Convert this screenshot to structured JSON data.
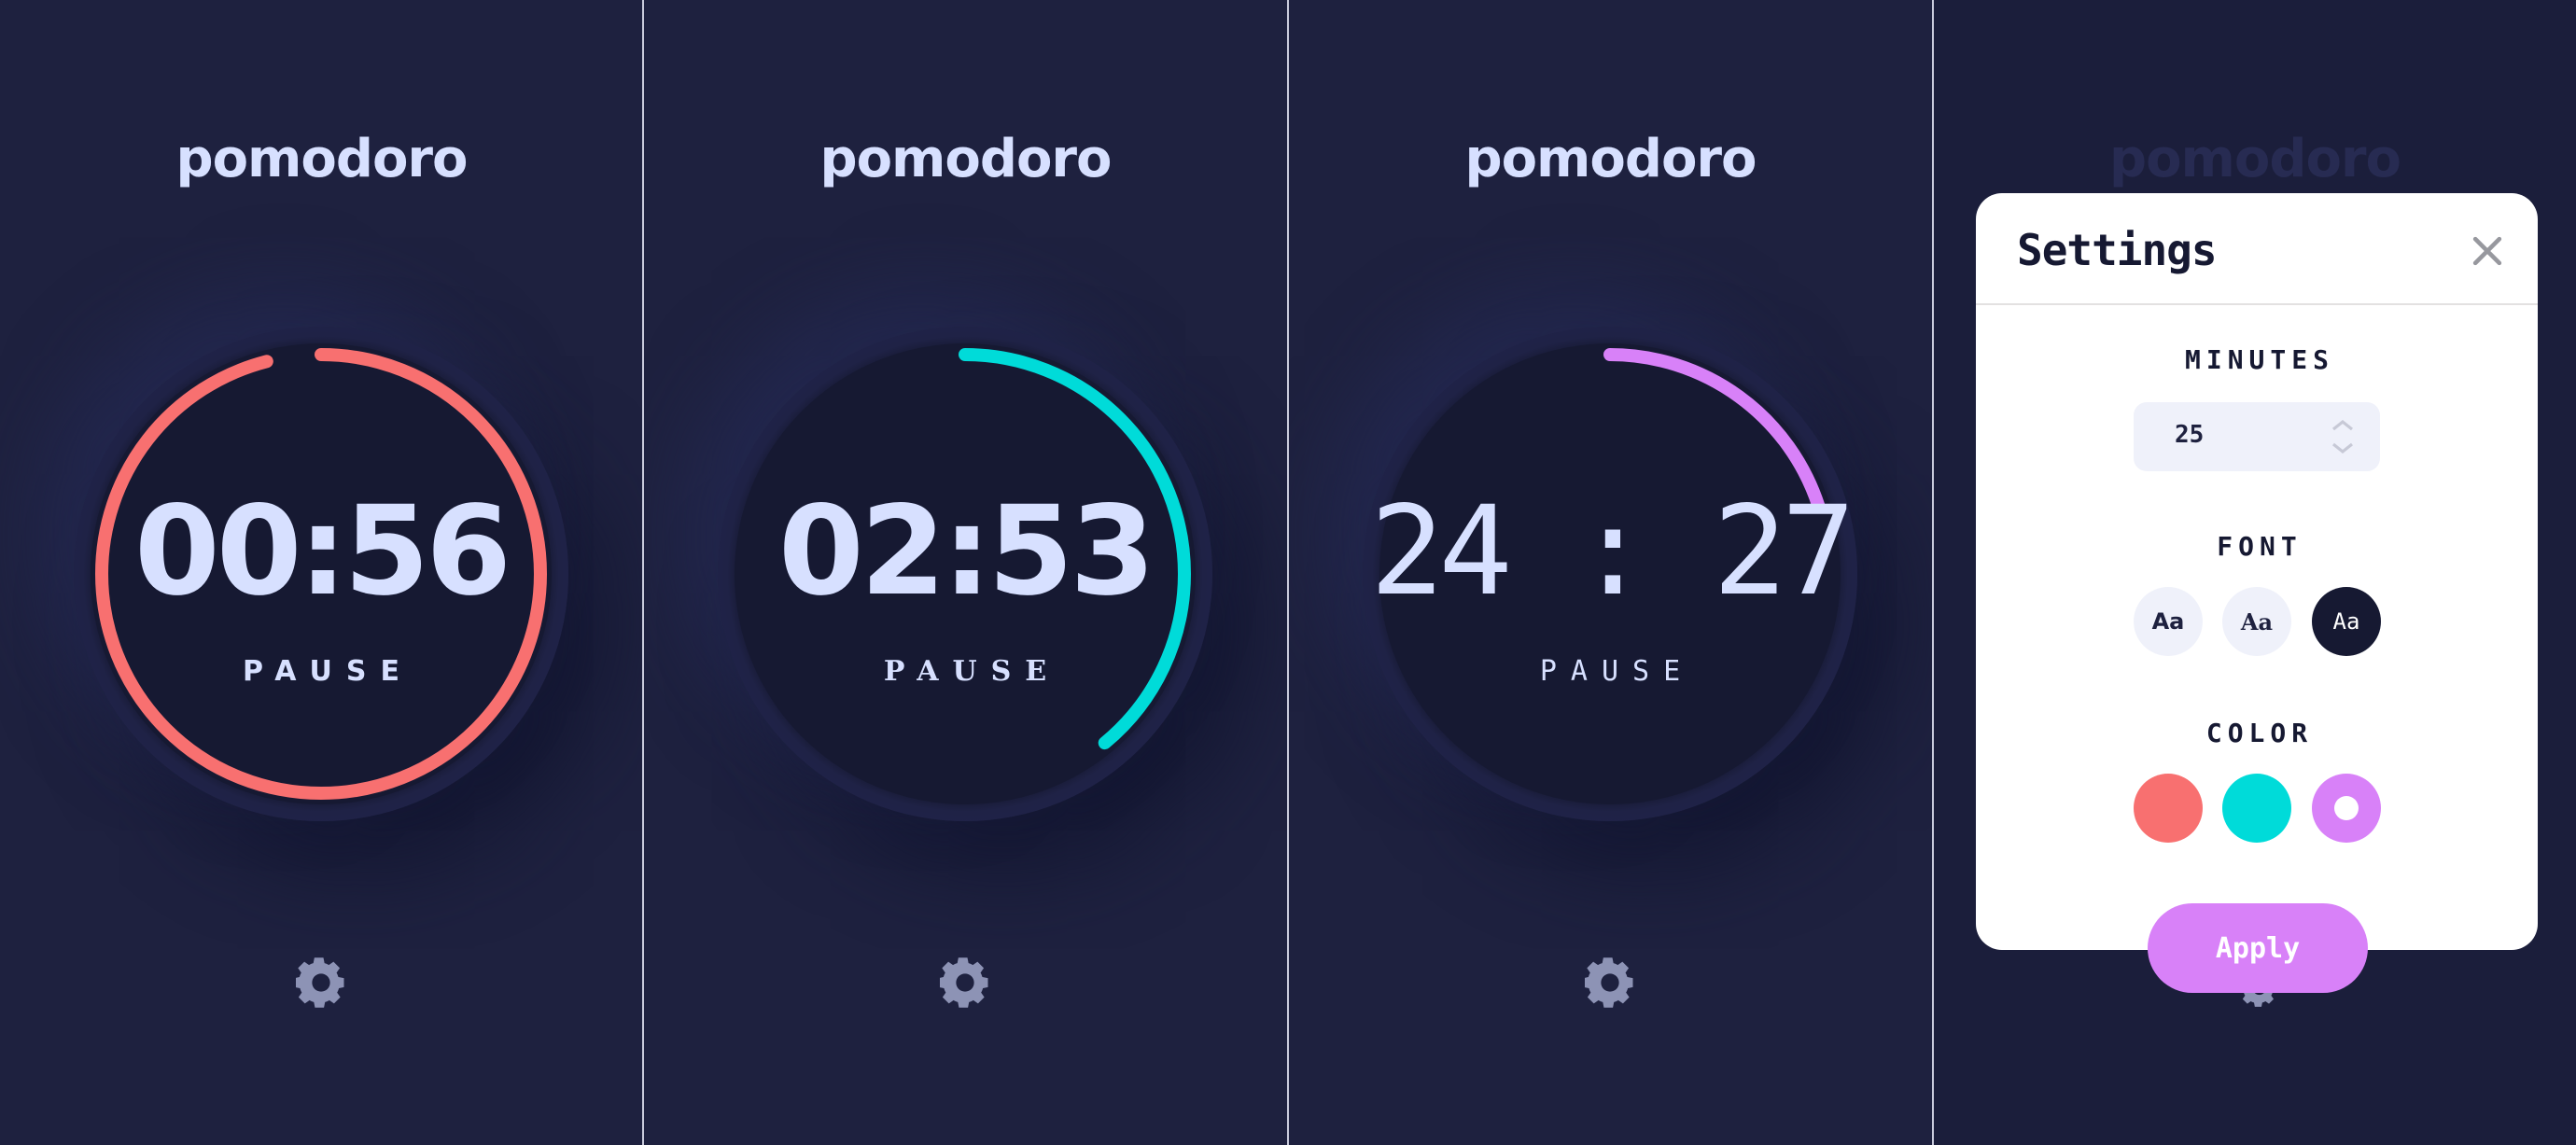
{
  "app": {
    "brand": "pomodoro",
    "colors": {
      "background": "#1e213f",
      "dial": "#161932",
      "text": "#d7e0ff",
      "red": "#f87070",
      "cyan": "#00dbd9",
      "violet": "#d881f8",
      "gear": "#8d93b5"
    }
  },
  "screens": [
    {
      "time": "00:56",
      "action": "PAUSE",
      "accent": "#f87070",
      "progress": 0.96,
      "font": "sans"
    },
    {
      "time": "02:53",
      "action": "PAUSE",
      "accent": "#00dbd9",
      "progress": 0.39,
      "font": "serif"
    },
    {
      "time": "24 : 27",
      "action": "PAUSE",
      "accent": "#d881f8",
      "progress": 0.2,
      "font": "mono"
    }
  ],
  "settings": {
    "title": "Settings",
    "close_icon": "close-icon",
    "minutes_label": "MINUTES",
    "minutes_value": "25",
    "font_label": "FONT",
    "font_options": [
      "Aa",
      "Aa",
      "Aa"
    ],
    "font_selected": 2,
    "color_label": "COLOR",
    "color_options": [
      "#f87070",
      "#00dbd9",
      "#d881f8"
    ],
    "color_selected": 2,
    "apply_label": "Apply"
  }
}
